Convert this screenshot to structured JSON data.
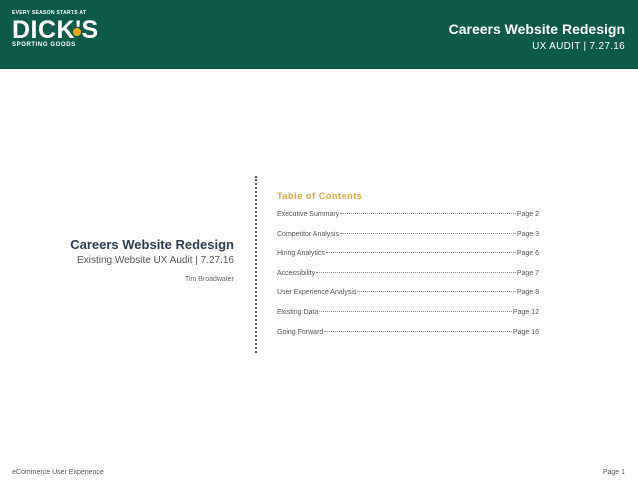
{
  "header": {
    "logo": {
      "tagline": "EVERY SEASON STARTS AT",
      "brand": "DICK'S",
      "sub": "SPORTING GOODS"
    },
    "title": "Careers Website Redesign",
    "subtitle": "UX AUDIT  |  7.27.16"
  },
  "cover": {
    "title": "Careers Website Redesign",
    "subtitle": "Existing Website UX Audit | 7.27.16",
    "author": "Tim Broadwater"
  },
  "toc": {
    "title": "Table of Contents",
    "items": [
      {
        "label": "Executive Summary",
        "page": "Page 2"
      },
      {
        "label": "Competitor Analysis",
        "page": "Page 3"
      },
      {
        "label": "Hiring Analytics",
        "page": "Page 6"
      },
      {
        "label": "Accessibility",
        "page": "Page 7"
      },
      {
        "label": "User Experience Analysis",
        "page": "Page 8"
      },
      {
        "label": "Existing Data",
        "page": "Page 12"
      },
      {
        "label": "Going Forward",
        "page": "Page 16"
      }
    ]
  },
  "footer": {
    "left": "eCommerce User Experience",
    "right": "Page 1"
  },
  "colors": {
    "header_bg": "#0e5a4a",
    "toc_title": "#e8a33a",
    "logo_ball": "#f2a900"
  }
}
